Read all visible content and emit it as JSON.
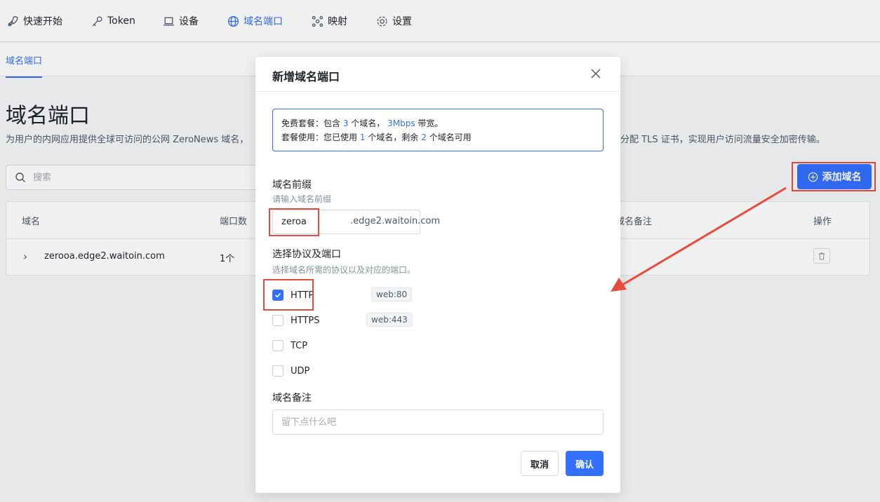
{
  "nav": {
    "items": [
      {
        "label": "快速开始",
        "icon": "rocket-icon"
      },
      {
        "label": "Token",
        "icon": "key-icon"
      },
      {
        "label": "设备",
        "icon": "laptop-icon"
      },
      {
        "label": "域名端口",
        "icon": "globe-icon",
        "active": true
      },
      {
        "label": "映射",
        "icon": "network-icon"
      },
      {
        "label": "设置",
        "icon": "gear-icon"
      }
    ]
  },
  "subtabs": {
    "active": "域名端口"
  },
  "page": {
    "title": "域名端口",
    "description_head": "为用户的内网应用提供全球可访问的公网 ZeroNews 域名，",
    "description_tail": "分配 TLS 证书，实现用户访问流量安全加密传输。",
    "search_placeholder": "搜索",
    "add_button": "添加域名"
  },
  "table": {
    "columns": [
      "域名",
      "端口数",
      "域名备注",
      "操作"
    ],
    "rows": [
      {
        "domain": "zerooa.edge2.waitoin.com",
        "ports": "1个",
        "note": ""
      }
    ]
  },
  "modal": {
    "title": "新增域名端口",
    "plan_line1": {
      "prefix": "免费套餐：包含 ",
      "count": "3",
      "mid": " 个域名，  ",
      "bandwidth": "3Mbps",
      "suffix": " 带宽。"
    },
    "plan_line2": {
      "prefix": "套餐使用：您已使用 ",
      "used": "1",
      "mid": " 个域名，剩余 ",
      "remaining": "2",
      "suffix": " 个域名可用"
    },
    "prefix_label": "域名前缀",
    "prefix_hint": "请输入域名前缀",
    "prefix_value": "zeroa",
    "domain_suffix": ".edge2.waitoin.com",
    "protocol_label": "选择协议及端口",
    "protocol_hint": "选择域名所需的协议以及对应的端口。",
    "protocols": [
      {
        "name": "HTTP",
        "checked": true,
        "port": "web:80"
      },
      {
        "name": "HTTPS",
        "checked": false,
        "port": "web:443"
      },
      {
        "name": "TCP",
        "checked": false,
        "port": ""
      },
      {
        "name": "UDP",
        "checked": false,
        "port": ""
      }
    ],
    "note_label": "域名备注",
    "note_placeholder": "留下点什么吧",
    "cancel": "取消",
    "confirm": "确认"
  },
  "colors": {
    "accent": "#3370ff",
    "annotation": "#e84b3c"
  }
}
